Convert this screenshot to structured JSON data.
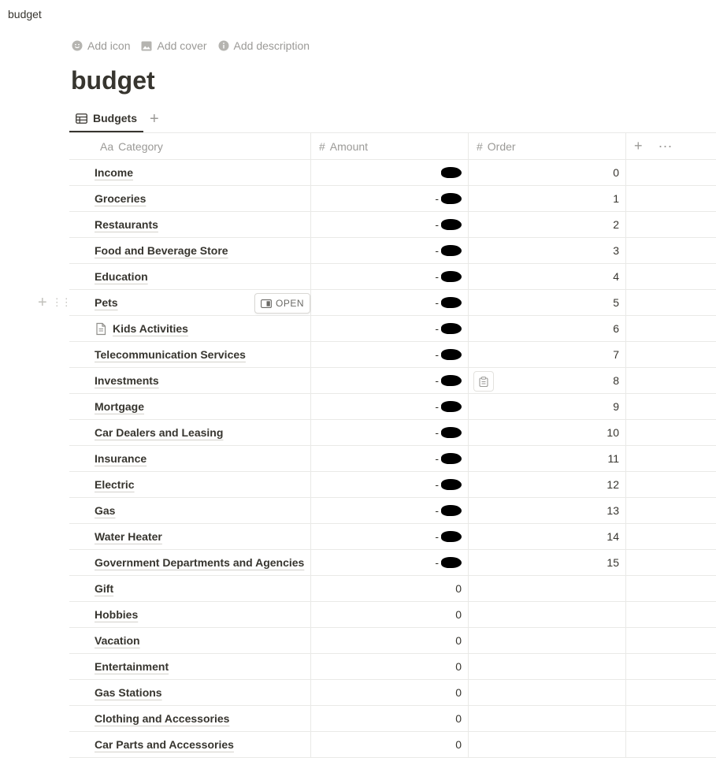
{
  "breadcrumb": "budget",
  "actions": {
    "add_icon": "Add icon",
    "add_cover": "Add cover",
    "add_description": "Add description"
  },
  "title": "budget",
  "tabs": [
    {
      "label": "Budgets",
      "icon": "table-icon"
    }
  ],
  "columns": {
    "category": "Category",
    "category_prefix": "Aa",
    "amount": "Amount",
    "order": "Order"
  },
  "open_label": "OPEN",
  "rows": [
    {
      "category": "Income",
      "amount": "",
      "amount_redacted": true,
      "order": "0"
    },
    {
      "category": "Groceries",
      "amount": "-",
      "amount_redacted": true,
      "order": "1"
    },
    {
      "category": "Restaurants",
      "amount": "-",
      "amount_redacted": true,
      "order": "2"
    },
    {
      "category": "Food and Beverage Store",
      "amount": "-",
      "amount_redacted": true,
      "order": "3"
    },
    {
      "category": "Education",
      "amount": "-",
      "amount_redacted": true,
      "order": "4"
    },
    {
      "category": "Pets",
      "amount": "-",
      "amount_redacted": true,
      "order": "5"
    },
    {
      "category": "Kids Activities",
      "amount": "-",
      "amount_redacted": true,
      "order": "6"
    },
    {
      "category": "Telecommunication Services",
      "amount": "-",
      "amount_redacted": true,
      "order": "7"
    },
    {
      "category": "Investments",
      "amount": "-",
      "amount_redacted": true,
      "order": "8"
    },
    {
      "category": "Mortgage",
      "amount": "-",
      "amount_redacted": true,
      "order": "9"
    },
    {
      "category": "Car Dealers and Leasing",
      "amount": "-",
      "amount_redacted": true,
      "order": "10"
    },
    {
      "category": "Insurance",
      "amount": "-",
      "amount_redacted": true,
      "order": "11"
    },
    {
      "category": "Electric",
      "amount": "-",
      "amount_redacted": true,
      "order": "12"
    },
    {
      "category": "Gas",
      "amount": "-",
      "amount_redacted": true,
      "order": "13"
    },
    {
      "category": "Water Heater",
      "amount": "-",
      "amount_redacted": true,
      "order": "14"
    },
    {
      "category": "Government Departments and Agencies",
      "amount": "-",
      "amount_redacted": true,
      "order": "15"
    },
    {
      "category": "Gift",
      "amount": "0",
      "amount_redacted": false,
      "order": ""
    },
    {
      "category": "Hobbies",
      "amount": "0",
      "amount_redacted": false,
      "order": ""
    },
    {
      "category": "Vacation",
      "amount": "0",
      "amount_redacted": false,
      "order": ""
    },
    {
      "category": "Entertainment",
      "amount": "0",
      "amount_redacted": false,
      "order": ""
    },
    {
      "category": "Gas Stations",
      "amount": "0",
      "amount_redacted": false,
      "order": ""
    },
    {
      "category": "Clothing and Accessories",
      "amount": "0",
      "amount_redacted": false,
      "order": ""
    },
    {
      "category": "Car Parts and Accessories",
      "amount": "0",
      "amount_redacted": false,
      "order": ""
    }
  ]
}
